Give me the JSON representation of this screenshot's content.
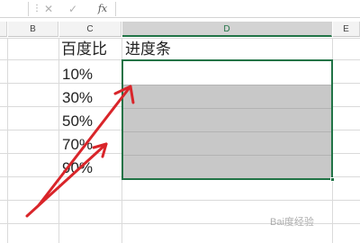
{
  "formula_bar": {
    "cancel_icon": "close-icon",
    "enter_icon": "check-icon",
    "fx_label": "fx",
    "formula_text": ""
  },
  "columns": [
    "B",
    "C",
    "D",
    "E"
  ],
  "selected_column": "D",
  "cells": {
    "C1": "百度比",
    "D1": "进度条",
    "C2": "10%",
    "C3": "30%",
    "C4": "50%",
    "C5": "70%",
    "C6": "90%"
  },
  "colors": {
    "selection_border": "#217346",
    "selected_fill": "#c8c8c8",
    "arrow": "#d9252a"
  },
  "watermark": "Bai度经验"
}
